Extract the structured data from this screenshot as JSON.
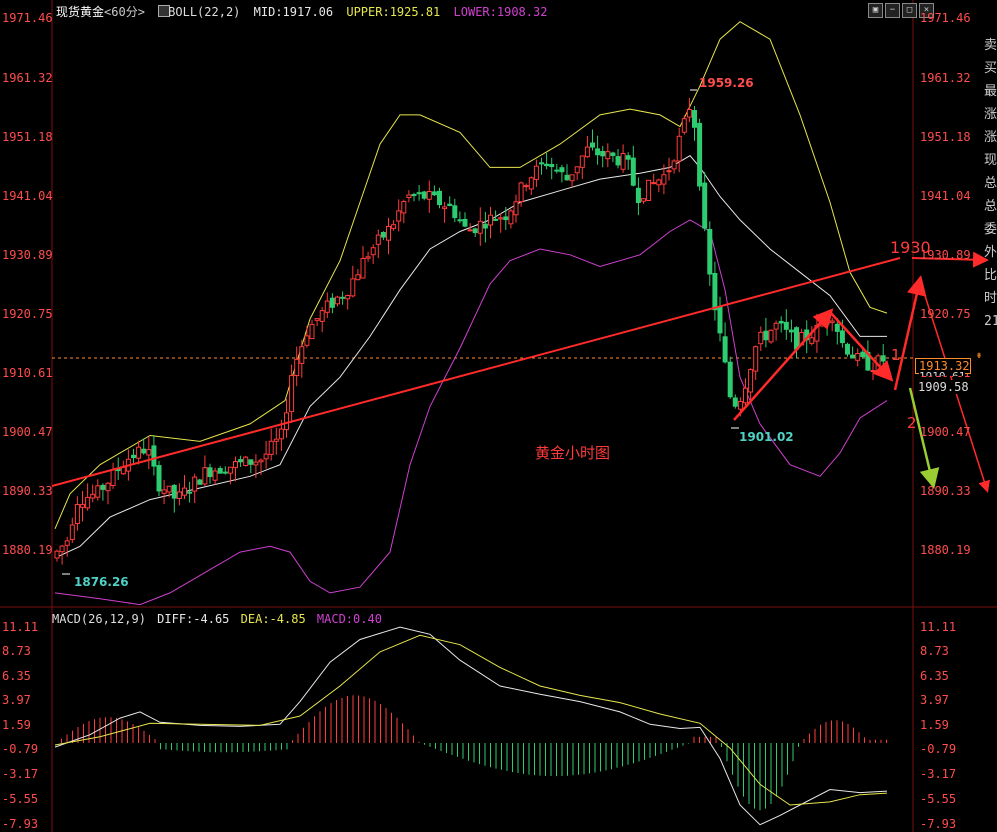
{
  "header": {
    "symbol": "现货黄金",
    "period": "<60分>",
    "boll": "BOLL(22,2)",
    "mid": "MID:1917.06",
    "upper": "UPPER:1925.81",
    "lower": "LOWER:1908.32"
  },
  "macd_header": {
    "name": "MACD(26,12,9)",
    "diff": "DIFF:-4.65",
    "dea": "DEA:-4.85",
    "macd": "MACD:0.40"
  },
  "price_axis": [
    "1971.46",
    "1961.32",
    "1951.18",
    "1941.04",
    "1930.89",
    "1920.75",
    "1910.61",
    "1900.47",
    "1890.33",
    "1880.19"
  ],
  "macd_axis": [
    "11.11",
    "8.73",
    "6.35",
    "3.97",
    "1.59",
    "-0.79",
    "-3.17",
    "-5.55",
    "-7.93"
  ],
  "annotations": {
    "high": "1959.26",
    "low_start": "1876.26",
    "low_mid": "1901.02",
    "title": "黄金小时图",
    "level": "1930",
    "wave1": "1",
    "wave2": "2"
  },
  "price_tags": {
    "current": "1913.32",
    "lower_tag": "1909.58",
    "hidden": "1910.61"
  },
  "side_chars": [
    "卖",
    "买",
    "最",
    "涨",
    "涨",
    "现",
    "总",
    "总",
    "委",
    "外",
    "比",
    "时",
    "21"
  ],
  "colors": {
    "up": "#ff3b3b",
    "down": "#2ecc71",
    "mid": "#e8e8e8",
    "upper": "#e6e64d",
    "lower": "#d040d0",
    "trend": "#ff2a2a",
    "axis": "#ff4d4d"
  },
  "chart_data": {
    "type": "candlestick",
    "period": "60分",
    "price_range": [
      1873,
      1975
    ],
    "macd_range": [
      -7.93,
      11.11
    ]
  }
}
